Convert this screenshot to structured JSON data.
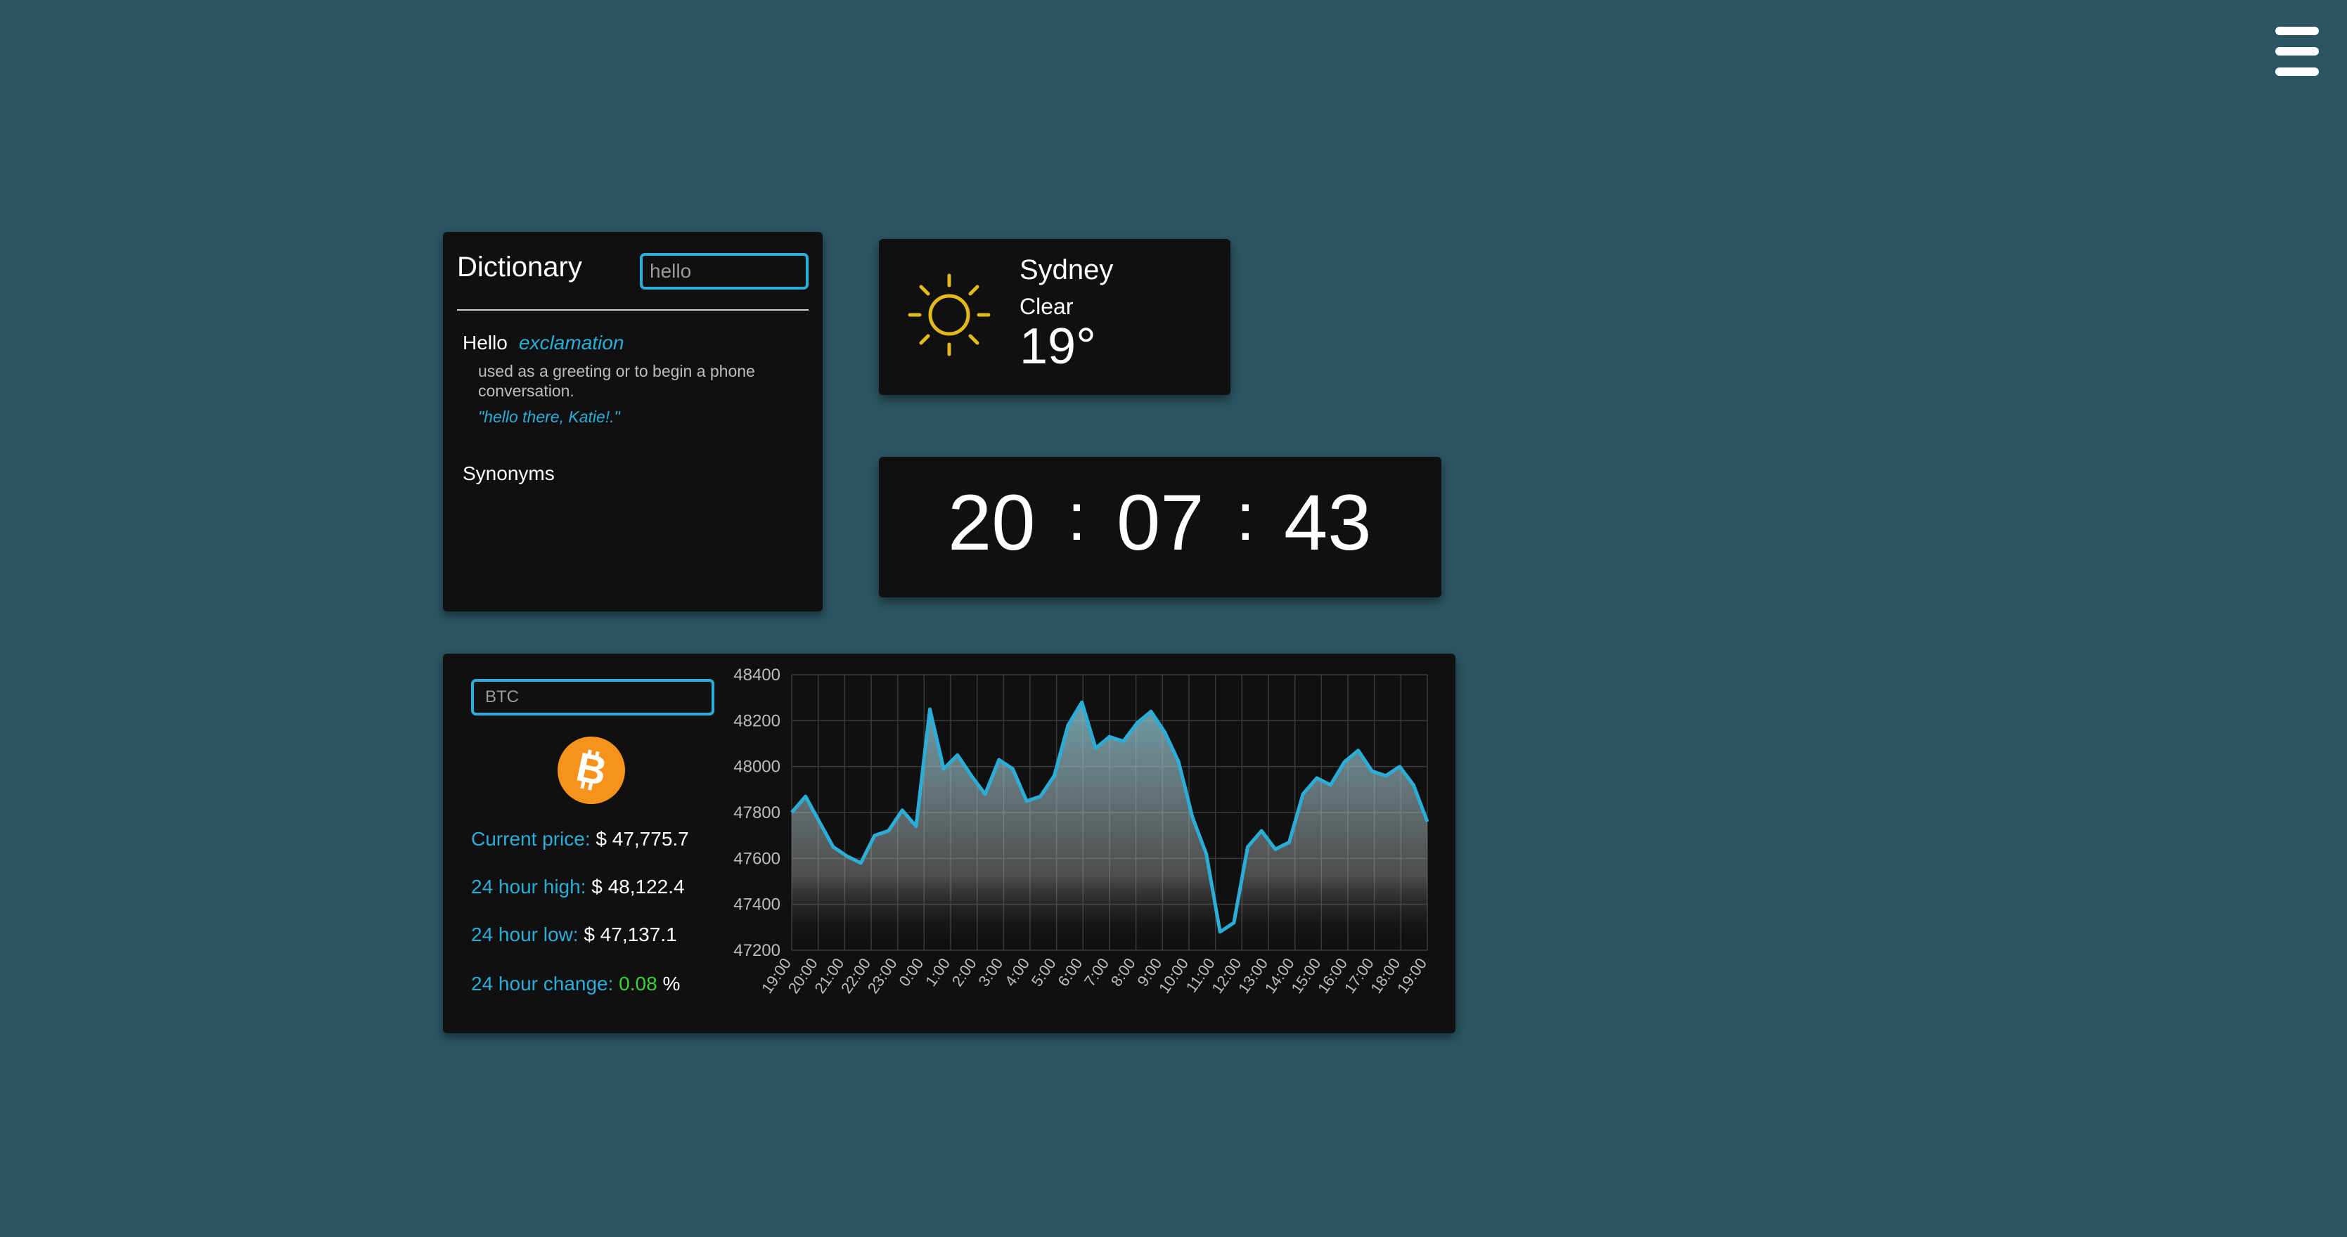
{
  "menu": {
    "icon": "hamburger-menu-icon"
  },
  "dictionary": {
    "title": "Dictionary",
    "search_value": "hello",
    "word": "Hello",
    "part_of_speech": "exclamation",
    "definition": "used as a greeting or to begin a phone conversation.",
    "example": "\"hello there, Katie!.\"",
    "synonyms_label": "Synonyms"
  },
  "weather": {
    "city": "Sydney",
    "condition": "Clear",
    "temperature": "19°",
    "icon": "sun-icon"
  },
  "clock": {
    "hours": "20",
    "minutes": "07",
    "seconds": "43",
    "separator": ":"
  },
  "crypto": {
    "search_value": "BTC",
    "icon": "bitcoin-icon",
    "current_price_label": "Current price:",
    "current_price": "$ 47,775.7",
    "high_label": "24 hour high:",
    "high": "$ 48,122.4",
    "low_label": "24 hour low:",
    "low": "$ 47,137.1",
    "change_label": "24 hour change:",
    "change": "0.08",
    "change_unit": "%"
  },
  "colors": {
    "accent": "#2aaed8",
    "background": "#2b5563",
    "card": "#101010",
    "positive": "#3bd23b",
    "bitcoin": "#f7931a",
    "sun": "#e4b91c"
  },
  "chart_data": {
    "type": "area",
    "title": "",
    "xlabel": "",
    "ylabel": "",
    "ylim": [
      47200,
      48400
    ],
    "yticks": [
      47200,
      47400,
      47600,
      47800,
      48000,
      48200,
      48400
    ],
    "x": [
      "19:00",
      "20:00",
      "21:00",
      "22:00",
      "23:00",
      "0:00",
      "1:00",
      "2:00",
      "3:00",
      "4:00",
      "5:00",
      "6:00",
      "7:00",
      "8:00",
      "9:00",
      "10:00",
      "11:00",
      "12:00",
      "13:00",
      "14:00",
      "15:00",
      "16:00",
      "17:00",
      "18:00",
      "19:00"
    ],
    "grid": true,
    "series": [
      {
        "color": "#2aaed8",
        "values": [
          47800,
          47870,
          47760,
          47650,
          47610,
          47580,
          47700,
          47720,
          47810,
          47740,
          48250,
          47990,
          48050,
          47960,
          47880,
          48030,
          47990,
          47850,
          47870,
          47960,
          48180,
          48280,
          48080,
          48130,
          48110,
          48190,
          48240,
          48150,
          48020,
          47780,
          47620,
          47280,
          47320,
          47650,
          47720,
          47640,
          47670,
          47880,
          47950,
          47920,
          48020,
          48070,
          47980,
          47960,
          48000,
          47920,
          47760
        ]
      }
    ]
  }
}
